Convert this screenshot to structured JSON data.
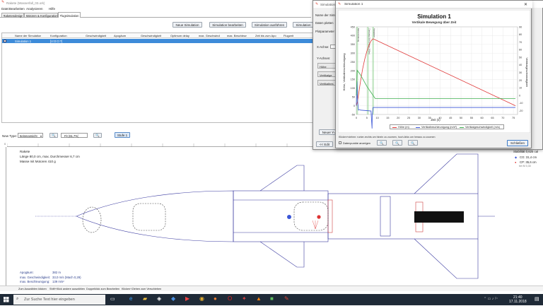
{
  "main_window": {
    "title": "Rakete (Wasserfall_03.ork)",
    "menu": [
      "Datei",
      "Bearbeiten",
      "Analysieren",
      "Hilfe"
    ],
    "tabs": [
      "Raketendesign",
      "Motoren & Konfiguration",
      "Flugsimulation"
    ],
    "sim_buttons": [
      "Neue Simulation",
      "Simulation bearbeiten",
      "Simulation ausführen",
      "Simulation"
    ],
    "table": {
      "headers": [
        "Name der Simulation",
        "Konfiguration",
        "Geschwindigkeit",
        "Apogäum",
        "Geschwindigkeit",
        "Optimum delay",
        "max. Geschwindi",
        "max. Beschleun",
        "Zeit bis zum Apo",
        "Flugzeit"
      ],
      "rows": [
        [
          "Simulation 1",
          "[V:O:O:?]",
          "",
          "",
          "",
          "",
          "",
          "",
          "",
          ""
        ]
      ]
    },
    "view_type_label": "New Type:",
    "view_type_value": "Seitenansicht",
    "zoom_value": "Fit (61,7%)",
    "stage_button": "Stufe 1",
    "rocket_name": "Rakete",
    "rocket_dims": "Länge 80,0 cm, max. Durchmesser 6,7 cm",
    "rocket_mass": "Masse mit Motoren 410 g",
    "stability": "Stabilität 0,625 cal",
    "cg": "CG: 31,4 cm",
    "cp": "CP: 35,6 cm",
    "mach": "bei M 0,30",
    "results": [
      {
        "label": "Apogäum:",
        "value": "382 m"
      },
      {
        "label": "max. Geschwindigkeit:",
        "value": "33,0 m/s  (Mach 0,29)"
      },
      {
        "label": "max. Beschleunigung:",
        "value": "139 m/s²"
      }
    ],
    "status_hints": [
      "Zum Auswählen klicken",
      "Shift+Klick andere auswählen",
      "Doppelklick zum Bearbeiten",
      "Klicken+Ziehen zum Verschieben"
    ],
    "ruler_labels": [
      "0",
      "10",
      "20",
      "30",
      "40",
      "50",
      "60",
      "70",
      "80",
      "90",
      "100",
      "110",
      "120",
      "130",
      "140",
      "150",
      "160"
    ]
  },
  "sim_dialog": {
    "title": "Simulation",
    "labels": [
      "Name der Simulation",
      "Daten plotten",
      "Plotparameter",
      "X-Achse:",
      "Y-Achsen:",
      "Höhe",
      "Vertikalge",
      "Vertikalbes"
    ],
    "new_y_button": "Neuer Y-A",
    "back_button": "<< Edit"
  },
  "plot_window": {
    "title": "Simulation 1",
    "close_button": "Schließen",
    "hint": "Klicken+ziehen: runter-rechts um hinein zu zoomen, hoch-links um heraus zu zoomen",
    "checkbox_label": "Datenpunkte anzeigen"
  },
  "chart_data": {
    "type": "line",
    "title": "Simulation 1",
    "subtitle": "Vertikale Bewegung über Zeit",
    "xlabel": "Zeit (s)",
    "ylabel_left": "Höhe, Vertikalbeschleunigung",
    "ylabel_right": "Vertikalgeschwindigkeit",
    "xlim": [
      0,
      77
    ],
    "ylim_left": [
      -50,
      450
    ],
    "ylim_right": [
      -25,
      90
    ],
    "x_ticks": [
      0,
      5,
      10,
      15,
      20,
      25,
      30,
      35,
      40,
      45,
      50,
      55,
      60,
      65,
      70,
      75
    ],
    "y_ticks_left": [
      -50,
      0,
      50,
      100,
      150,
      200,
      250,
      300,
      350,
      400,
      450
    ],
    "y_ticks_right": [
      -20,
      -10,
      0,
      10,
      20,
      30,
      40,
      50,
      60,
      70,
      80,
      90
    ],
    "event_labels": [
      "Motorzündung",
      "Zündung 30m (Höhe 300m)",
      "Apogäum"
    ],
    "series": [
      {
        "name": "Höhe (m)",
        "color": "#e03a3a",
        "axis": "left",
        "x": [
          0,
          0.5,
          1,
          2,
          3,
          4,
          5,
          6,
          7,
          8,
          76
        ],
        "y": [
          0,
          20,
          60,
          140,
          210,
          265,
          310,
          345,
          370,
          382,
          0
        ]
      },
      {
        "name": "Vertikalbeschleunigung (m/s²)",
        "color": "#3b56d6",
        "axis": "left",
        "x": [
          0,
          0.3,
          0.6,
          1,
          1.5,
          2,
          7,
          7.5,
          7.6,
          8,
          76
        ],
        "y": [
          0,
          140,
          30,
          -25,
          -22,
          -25,
          -30,
          -130,
          -50,
          -10,
          -10
        ]
      },
      {
        "name": "Vertikalgeschwindigkeit (m/s)",
        "color": "#3cae4e",
        "axis": "right",
        "x": [
          0,
          0.4,
          1.5,
          3,
          5,
          7,
          8,
          9,
          76
        ],
        "y": [
          0,
          33,
          29,
          22,
          12,
          4,
          0,
          -4,
          -4
        ]
      }
    ]
  },
  "taskbar": {
    "search_placeholder": "Zur Suche Text hier eingeben",
    "time": "21:40",
    "date": "17.11.2018"
  }
}
